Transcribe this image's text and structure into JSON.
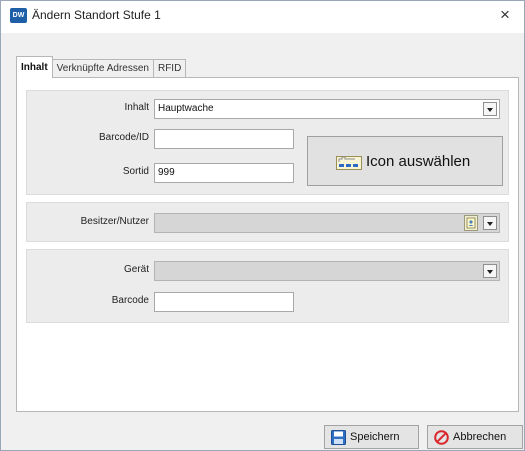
{
  "window": {
    "app_icon_text": "DW",
    "title": "Ändern Standort Stufe 1",
    "close_glyph": "×"
  },
  "tabs": [
    {
      "label": "Inhalt",
      "active": true
    },
    {
      "label": "Verknüpfte Adressen",
      "active": false
    },
    {
      "label": "RFID",
      "active": false
    }
  ],
  "form": {
    "inhalt_label": "Inhalt",
    "inhalt_value": "Hauptwache",
    "barcode_id_label": "Barcode/ID",
    "barcode_id_value": "",
    "sortid_label": "Sortid",
    "sortid_value": "999",
    "icon_button_label": "Icon auswählen",
    "besitzer_label": "Besitzer/Nutzer",
    "besitzer_value": "",
    "geraet_label": "Gerät",
    "geraet_value": "",
    "barcode_label": "Barcode",
    "barcode_value": ""
  },
  "buttons": {
    "save_label": "Speichern",
    "cancel_label": "Abbrechen"
  },
  "icons": {
    "app": "app-logo-icon",
    "close": "close-icon",
    "dropdown": "chevron-down-icon",
    "icon_picker": "icon-image-icon",
    "address_book": "address-book-icon",
    "save": "floppy-disk-icon",
    "cancel": "cancel-circle-icon"
  },
  "colors": {
    "accent": "#1f5fa8",
    "cancel_red": "#d9262b",
    "group_bg": "#ececec",
    "disabled_field": "#d6d6d6"
  }
}
